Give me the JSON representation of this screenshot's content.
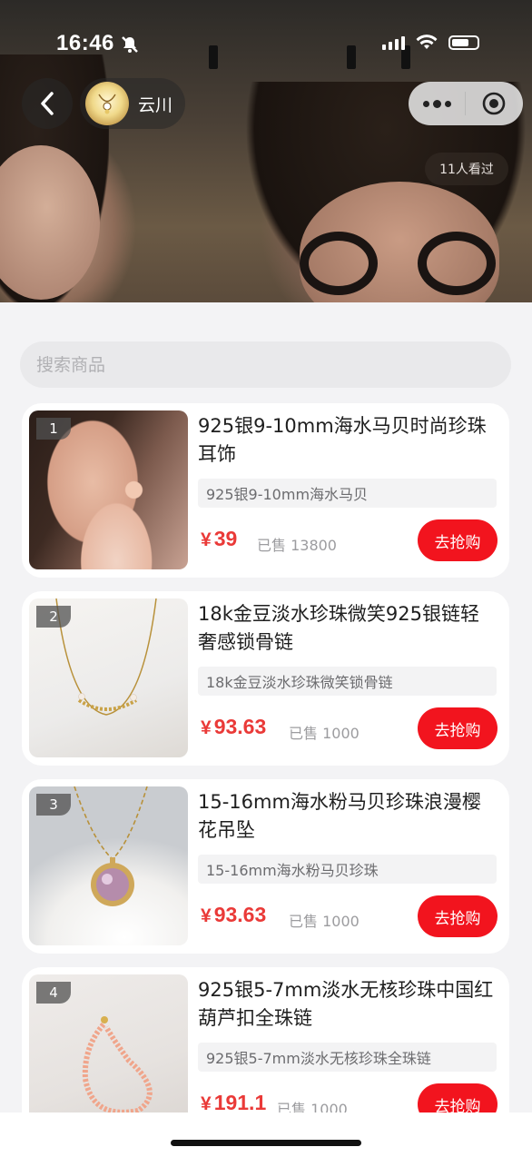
{
  "status_bar": {
    "time": "16:46"
  },
  "header": {
    "shop_name": "云川",
    "views": "11人看过"
  },
  "search": {
    "placeholder": "搜索商品"
  },
  "products": [
    {
      "rank": "1",
      "title": "925银9-10mm海水马贝时尚珍珠耳饰",
      "subtitle": "925银9-10mm海水马贝",
      "currency": "¥",
      "price": "39",
      "sold": "已售 13800",
      "button": "去抢购"
    },
    {
      "rank": "2",
      "title": "18k金豆淡水珍珠微笑925银链轻奢感锁骨链",
      "subtitle": "18k金豆淡水珍珠微笑锁骨链",
      "currency": "¥",
      "price": "93.63",
      "sold": "已售 1000",
      "button": "去抢购"
    },
    {
      "rank": "3",
      "title": "15-16mm海水粉马贝珍珠浪漫樱花吊坠",
      "subtitle": "15-16mm海水粉马贝珍珠",
      "currency": "¥",
      "price": "93.63",
      "sold": "已售 1000",
      "button": "去抢购"
    },
    {
      "rank": "4",
      "title": "925银5-7mm淡水无核珍珠中国红葫芦扣全珠链",
      "subtitle": "925银5-7mm淡水无核珍珠全珠链",
      "currency": "¥",
      "price": "191.1",
      "sold": "已售 1000",
      "button": "去抢购"
    }
  ],
  "colors": {
    "accent_red": "#f2141e",
    "price_red": "#ea3a38"
  }
}
